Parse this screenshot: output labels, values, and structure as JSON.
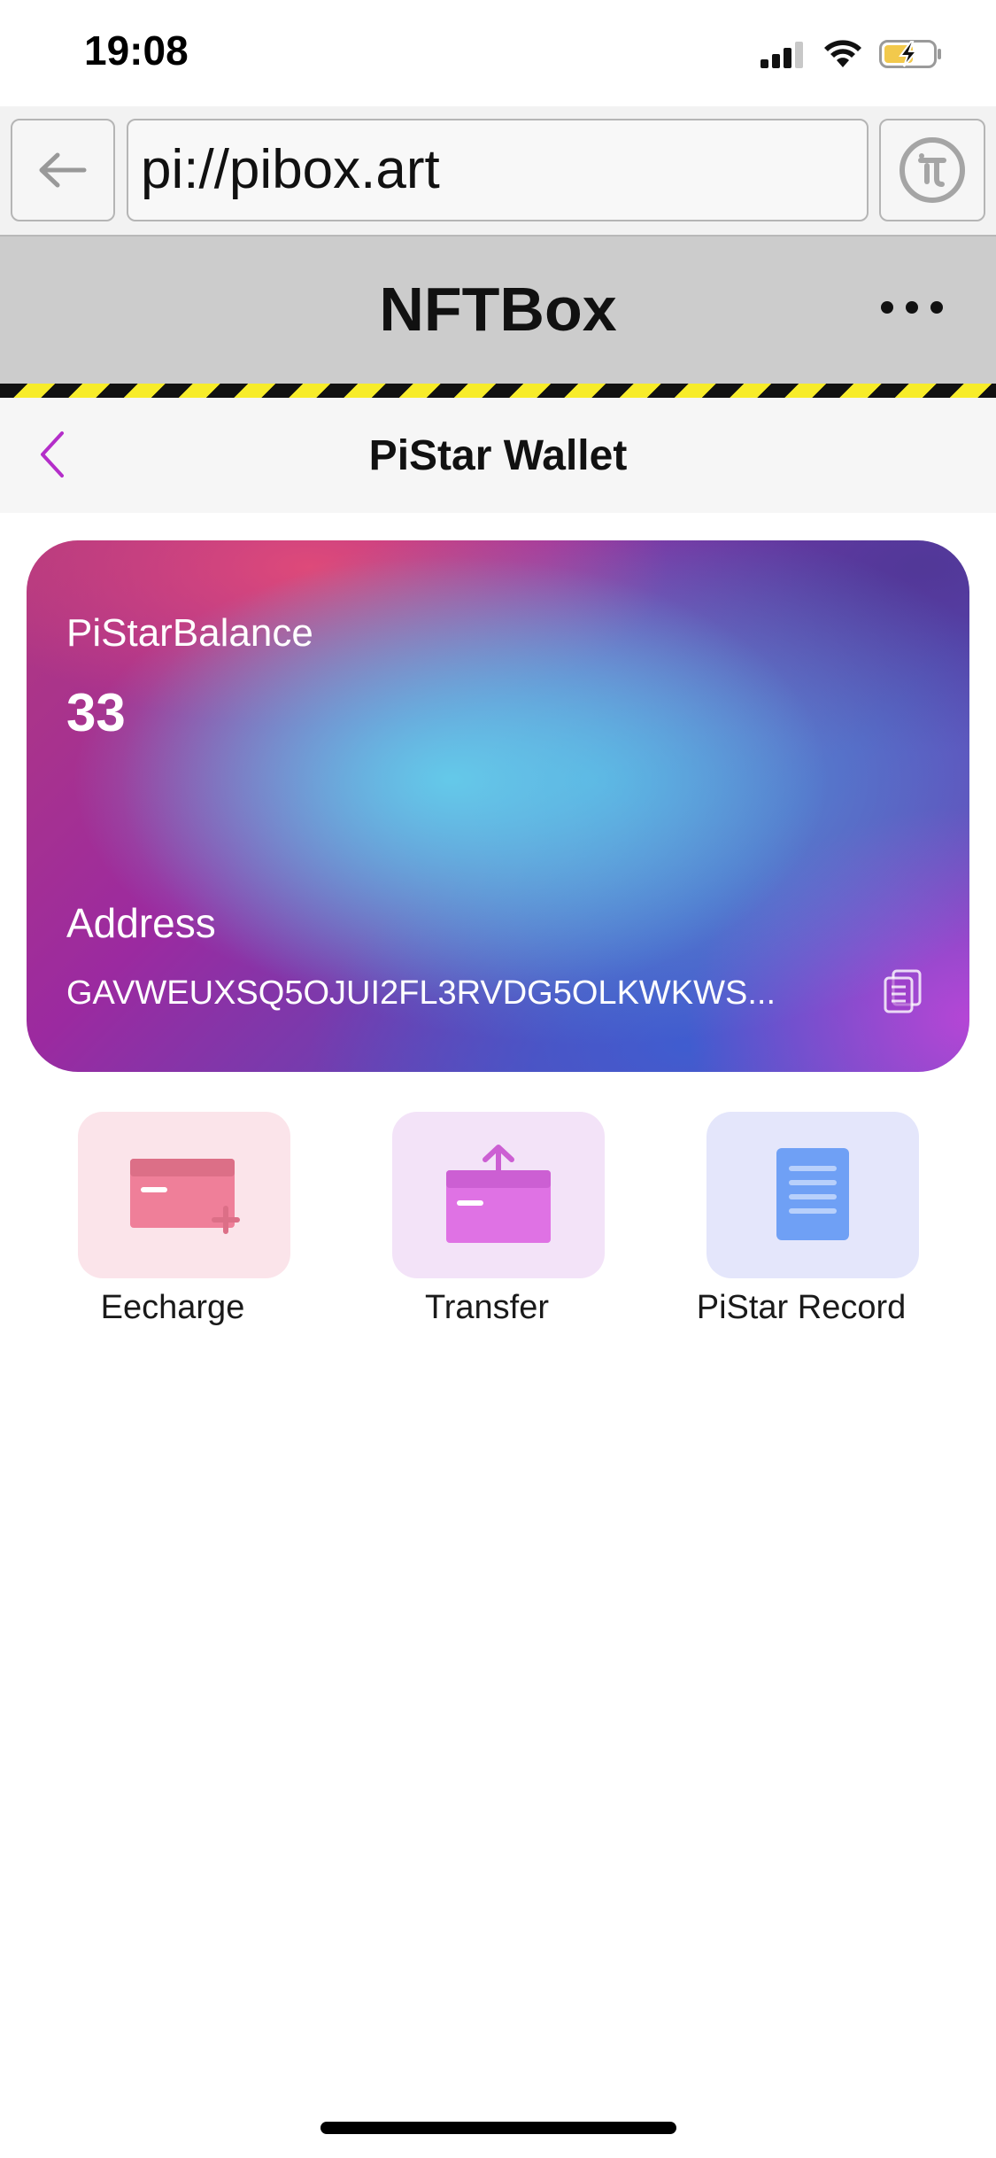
{
  "status_bar": {
    "time": "19:08"
  },
  "browser": {
    "url": "pi://pibox.art"
  },
  "app_header": {
    "title": "NFTBox"
  },
  "page_header": {
    "title": "PiStar Wallet"
  },
  "wallet_card": {
    "balance_label": "PiStarBalance",
    "balance_value": "33",
    "address_label": "Address",
    "address_value": "GAVWEUXSQ5OJUI2FL3RVDG5OLKWKWS..."
  },
  "actions": [
    {
      "label": "Eecharge",
      "icon": "card-add-icon",
      "tile_color": "#fbe4ea",
      "icon_color": "#ef7f99"
    },
    {
      "label": "Transfer",
      "icon": "card-upload-icon",
      "tile_color": "#f3e3f8",
      "icon_color": "#df72e4"
    },
    {
      "label": "PiStar Record",
      "icon": "document-icon",
      "tile_color": "#e4e6fb",
      "icon_color": "#6fa0f5"
    }
  ],
  "colors": {
    "accent": "#b42ec9",
    "header_bg": "#cccccc",
    "hazard_yellow": "#f7ec2a",
    "battery_fill": "#f2c94c"
  }
}
